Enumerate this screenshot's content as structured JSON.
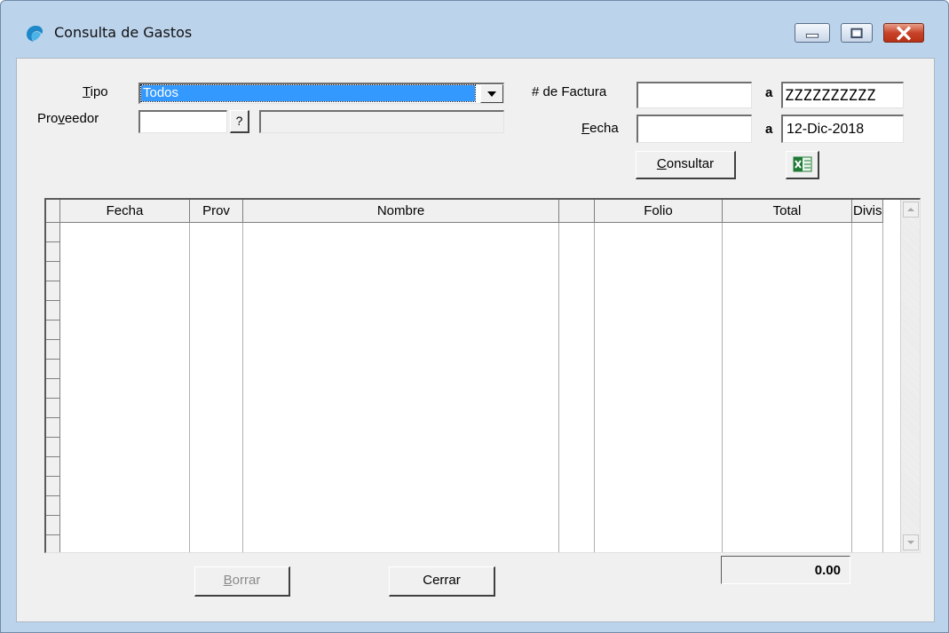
{
  "window": {
    "title": "Consulta de Gastos"
  },
  "filters": {
    "tipo_label": "Tipo",
    "tipo_value": "Todos",
    "proveedor_label": "Proveedor",
    "proveedor_lookup": "?",
    "factura_label": "# de Factura",
    "factura_a_label": "a",
    "factura_to": "ZZZZZZZZZZ",
    "fecha_label": "Fecha",
    "fecha_a_label": "a",
    "fecha_to": "12-Dic-2018",
    "consultar_label": "Consultar"
  },
  "grid": {
    "columns": [
      "Fecha",
      "Prov",
      "Nombre",
      "",
      "Folio",
      "Total",
      "Divis"
    ]
  },
  "footer": {
    "total": "0.00",
    "borrar_label": "Borrar",
    "cerrar_label": "Cerrar"
  },
  "colors": {
    "selection": "#3399ff",
    "excel_green": "#1f7a35"
  }
}
